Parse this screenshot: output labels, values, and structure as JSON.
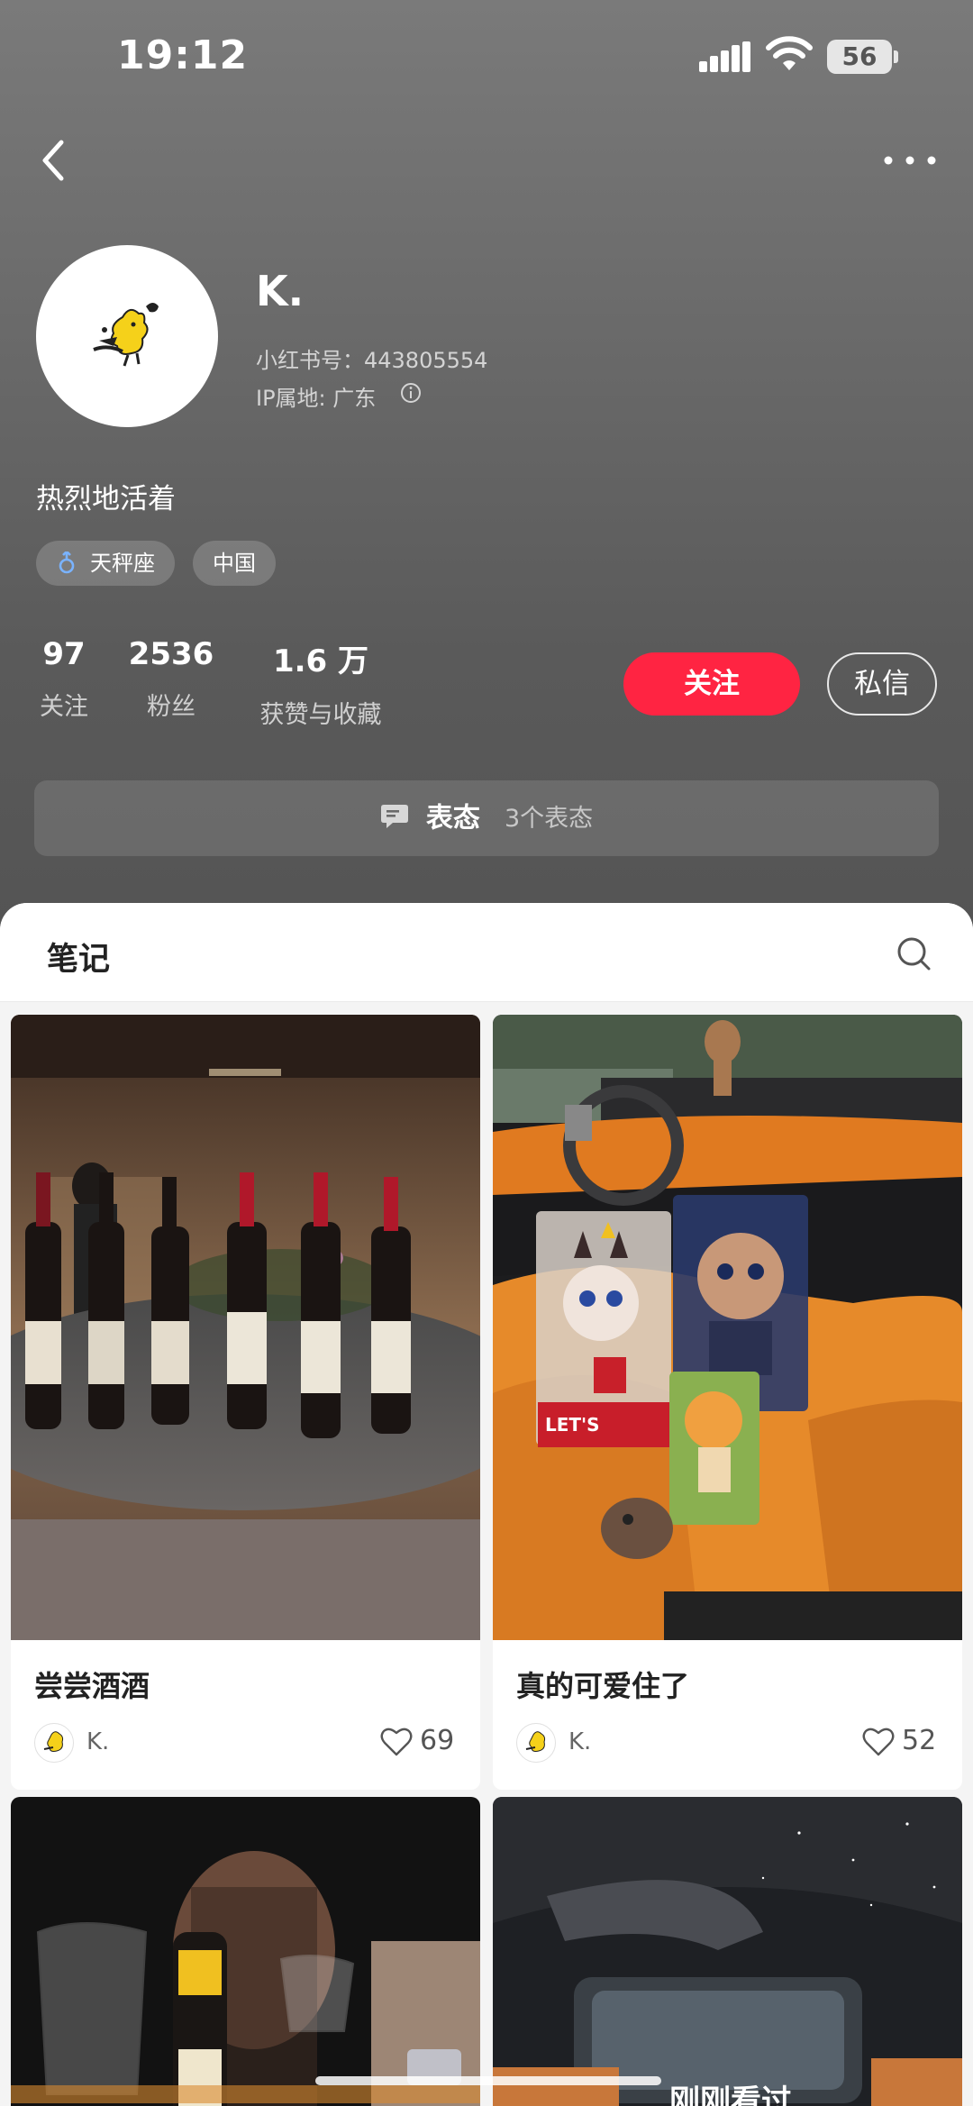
{
  "status_bar": {
    "time": "19:12",
    "battery": "56"
  },
  "nav": {
    "back_icon": "chevron-left-icon",
    "more_icon": "more-dots-icon"
  },
  "profile": {
    "nickname": "K.",
    "user_id": "小红书号：443805554",
    "ip_location": "IP属地: 广东",
    "bio": "热烈地活着",
    "tags": [
      {
        "icon": "female-symbol-icon",
        "label": "天秤座"
      },
      {
        "label": "中国"
      }
    ]
  },
  "stats": {
    "following": {
      "value": "97",
      "label": "关注"
    },
    "fans": {
      "value": "2536",
      "label": "粉丝"
    },
    "likes": {
      "value": "1.6 万",
      "label": "获赞与收藏"
    }
  },
  "actions": {
    "follow": "关注",
    "message": "私信"
  },
  "reactions": {
    "title": "表态",
    "count": "3个表态"
  },
  "tabs": {
    "notes": "笔记"
  },
  "notes": [
    {
      "title": "尝尝酒酒",
      "author": "K.",
      "likes": "69"
    },
    {
      "title": "真的可爱住了",
      "author": "K.",
      "likes": "52"
    },
    {
      "title": "",
      "author": "",
      "likes": ""
    },
    {
      "title": "刚刚看过",
      "author": "",
      "likes": ""
    }
  ],
  "colors": {
    "accent": "#ff2442",
    "header_bg": "#6a6a6a"
  }
}
